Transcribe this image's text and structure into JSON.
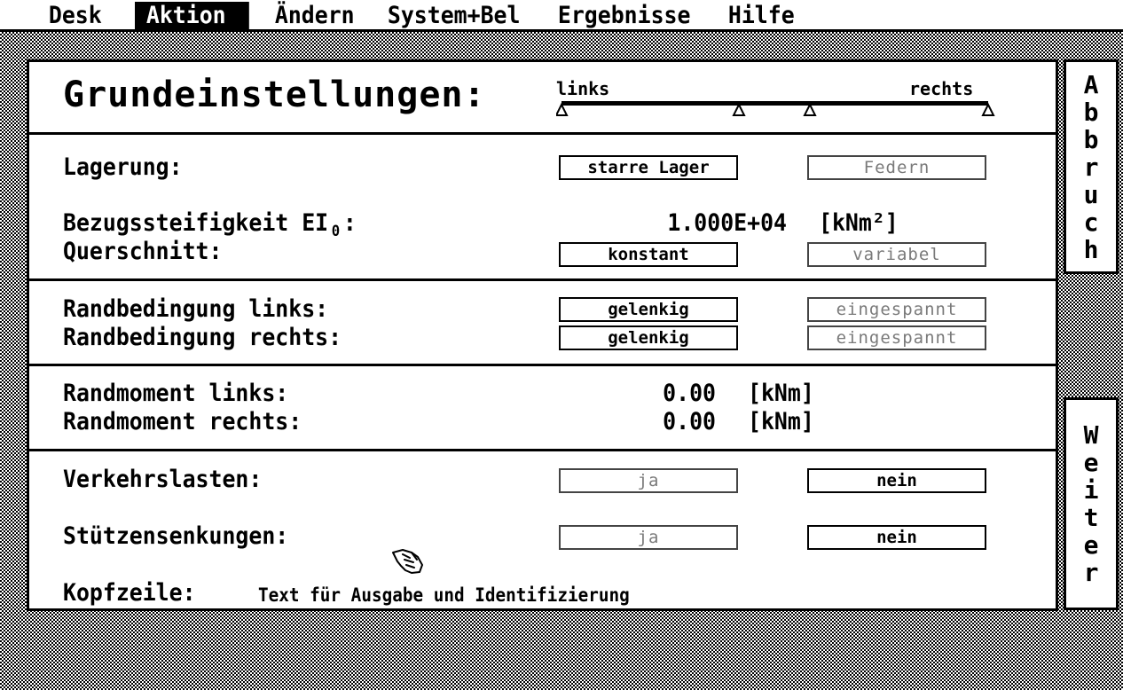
{
  "menu": {
    "items": [
      "Desk",
      "Aktion",
      "Ändern",
      "System+Bel",
      "Ergebnisse",
      "Hilfe"
    ],
    "active": "Aktion"
  },
  "header": {
    "title": "Grundeinstellungen:",
    "beam_left": "links",
    "beam_right": "rechts"
  },
  "lagerung": {
    "label": "Lagerung:",
    "option1": "starre Lager",
    "option2": "Federn"
  },
  "steifigkeit": {
    "label": "Bezugssteifigkeit EI",
    "subscript": "0",
    "colon": ":",
    "value": "1.000E+04",
    "unit": "[kNm²]"
  },
  "querschnitt": {
    "label": "Querschnitt:",
    "option1": "konstant",
    "option2": "variabel"
  },
  "rand_links": {
    "label": "Randbedingung links:",
    "option1": "gelenkig",
    "option2": "eingespannt"
  },
  "rand_rechts": {
    "label": "Randbedingung rechts:",
    "option1": "gelenkig",
    "option2": "eingespannt"
  },
  "moment_links": {
    "label": "Randmoment links:",
    "value": "0.00",
    "unit": "[kNm]"
  },
  "moment_rechts": {
    "label": "Randmoment rechts:",
    "value": "0.00",
    "unit": "[kNm]"
  },
  "verkehr": {
    "label": "Verkehrslasten:",
    "option1": "ja",
    "option2": "nein"
  },
  "stuetzen": {
    "label": "Stützensenkungen:",
    "option1": "ja",
    "option2": "nein"
  },
  "kopfzeile": {
    "label": "Kopfzeile:",
    "value": "Text für Ausgabe und Identifizierung"
  },
  "buttons": {
    "abbruch": "Abbruch",
    "weiter": "Weiter"
  }
}
